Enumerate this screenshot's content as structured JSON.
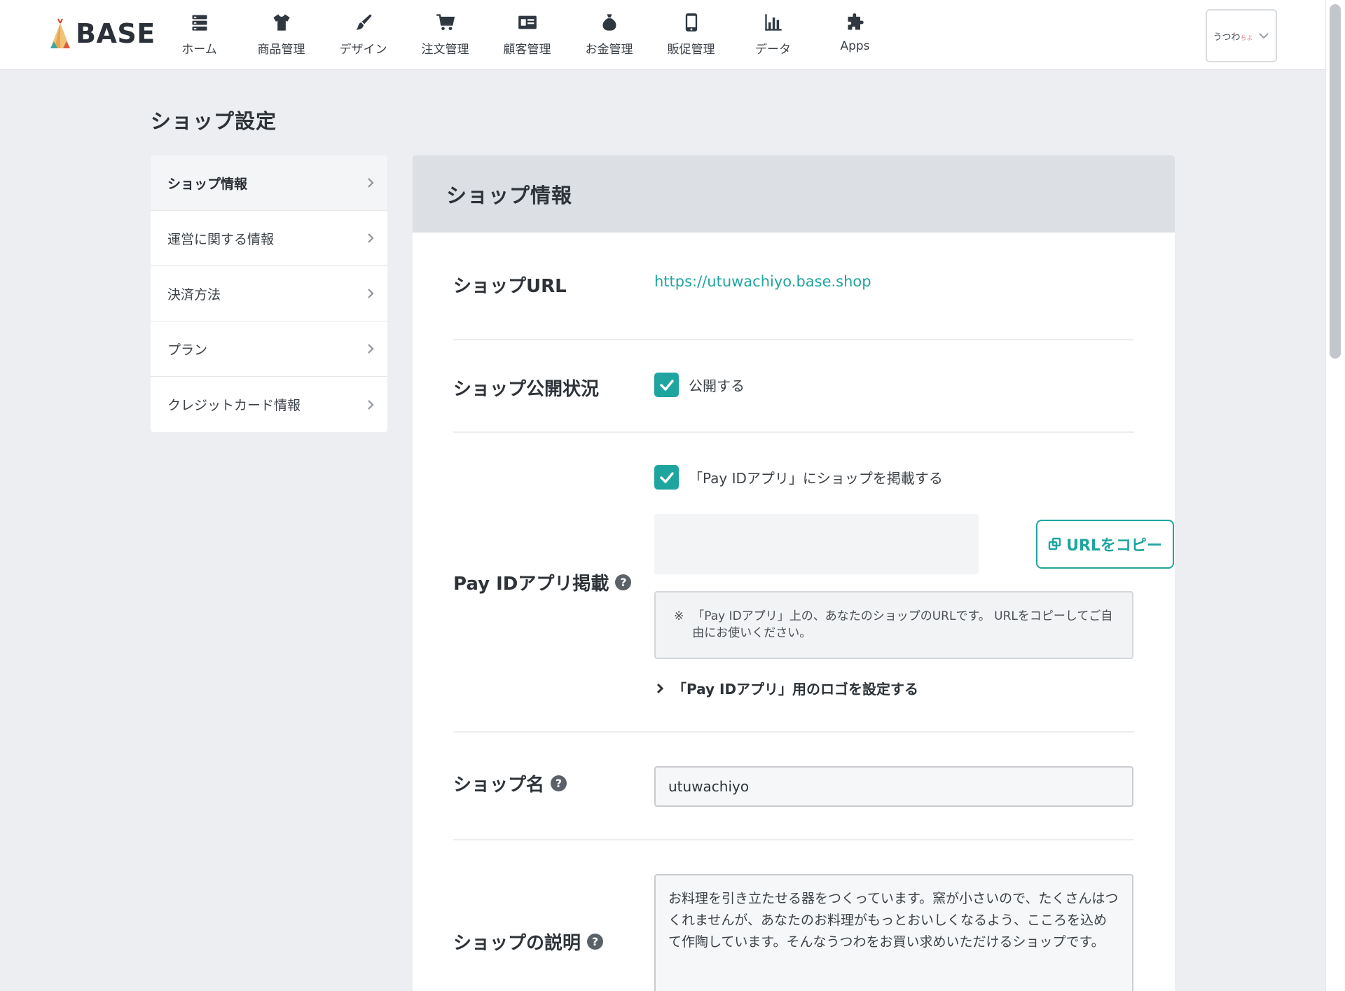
{
  "app": {
    "logo_text": "BASE"
  },
  "nav": [
    {
      "label": "ホーム",
      "icon": "server-stack-icon"
    },
    {
      "label": "商品管理",
      "icon": "tshirt-icon"
    },
    {
      "label": "デザイン",
      "icon": "paint-brush-icon"
    },
    {
      "label": "注文管理",
      "icon": "cart-icon"
    },
    {
      "label": "顧客管理",
      "icon": "id-card-icon"
    },
    {
      "label": "お金管理",
      "icon": "money-bag-icon"
    },
    {
      "label": "販促管理",
      "icon": "smartphone-icon"
    },
    {
      "label": "データ",
      "icon": "bar-chart-icon"
    },
    {
      "label": "Apps",
      "icon": "puzzle-icon"
    }
  ],
  "account": {
    "name": "うつわ",
    "mark": "ちよ"
  },
  "page": {
    "title": "ショップ設定"
  },
  "sidebar": {
    "items": [
      {
        "label": "ショップ情報",
        "active": true
      },
      {
        "label": "運営に関する情報",
        "active": false
      },
      {
        "label": "決済方法",
        "active": false
      },
      {
        "label": "プラン",
        "active": false
      },
      {
        "label": "クレジットカード情報",
        "active": false
      }
    ]
  },
  "panel": {
    "title": "ショップ情報",
    "shop_url": {
      "label": "ショップURL",
      "value": "https://utuwachiyo.base.shop"
    },
    "visibility": {
      "label": "ショップ公開状況",
      "checkbox_label": "公開する",
      "checked": true
    },
    "payid": {
      "label": "Pay IDアプリ掲載",
      "checkbox_label": "「Pay IDアプリ」にショップを掲載する",
      "checked": true,
      "url_value": "",
      "copy_button": "URLをコピー",
      "note_mark": "※",
      "note": "「Pay IDアプリ」上の、あなたのショップのURLです。 URLをコピーしてご自由にお使いください。",
      "logo_link": "「Pay IDアプリ」用のロゴを設定する"
    },
    "shop_name": {
      "label": "ショップ名",
      "value": "utuwachiyo"
    },
    "description": {
      "label": "ショップの説明",
      "value": "お料理を引き立たせる器をつくっています。窯が小さいので、たくさんはつくれませんが、あなたのお料理がもっとおいしくなるよう、こころを込めて作陶しています。そんなうつわをお買い求めいただけるショップです。"
    },
    "help_glyph": "?"
  },
  "colors": {
    "accent": "#1fa5a0",
    "background": "#eceef1",
    "panel_header": "#dcdfe3"
  }
}
